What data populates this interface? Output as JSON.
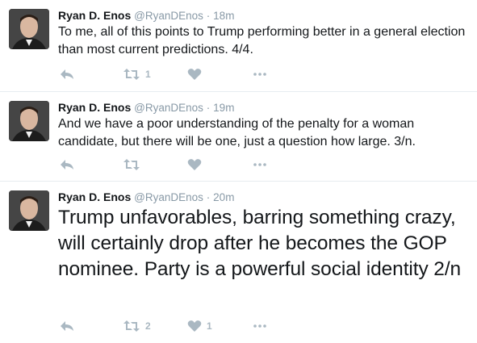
{
  "tweets": [
    {
      "name": "Ryan D. Enos",
      "handle": "@RyanDEnos",
      "separator": "·",
      "time": "18m",
      "text": "To me, all of this points to Trump performing better in a general election than most current predictions.  4/4.",
      "retweets": "1",
      "likes": ""
    },
    {
      "name": "Ryan D. Enos",
      "handle": "@RyanDEnos",
      "separator": "·",
      "time": "19m",
      "text": "And we have a poor understanding of the penalty for a woman candidate, but there will be one, just a question how large. 3/n.",
      "retweets": "",
      "likes": ""
    },
    {
      "name": "Ryan D. Enos",
      "handle": "@RyanDEnos",
      "separator": "·",
      "time": "20m",
      "text": "Trump unfavorables, barring something crazy, will certainly drop after he becomes the GOP nominee. Party is a powerful social identity 2/n",
      "retweets": "2",
      "likes": "1"
    }
  ],
  "icons": {
    "reply": "reply-icon",
    "retweet": "retweet-icon",
    "like": "heart-icon",
    "more": "more-icon"
  },
  "colors": {
    "name": "#14171a",
    "meta": "#8899a6",
    "action": "#aab8c2",
    "divider": "#e6ecf0"
  }
}
